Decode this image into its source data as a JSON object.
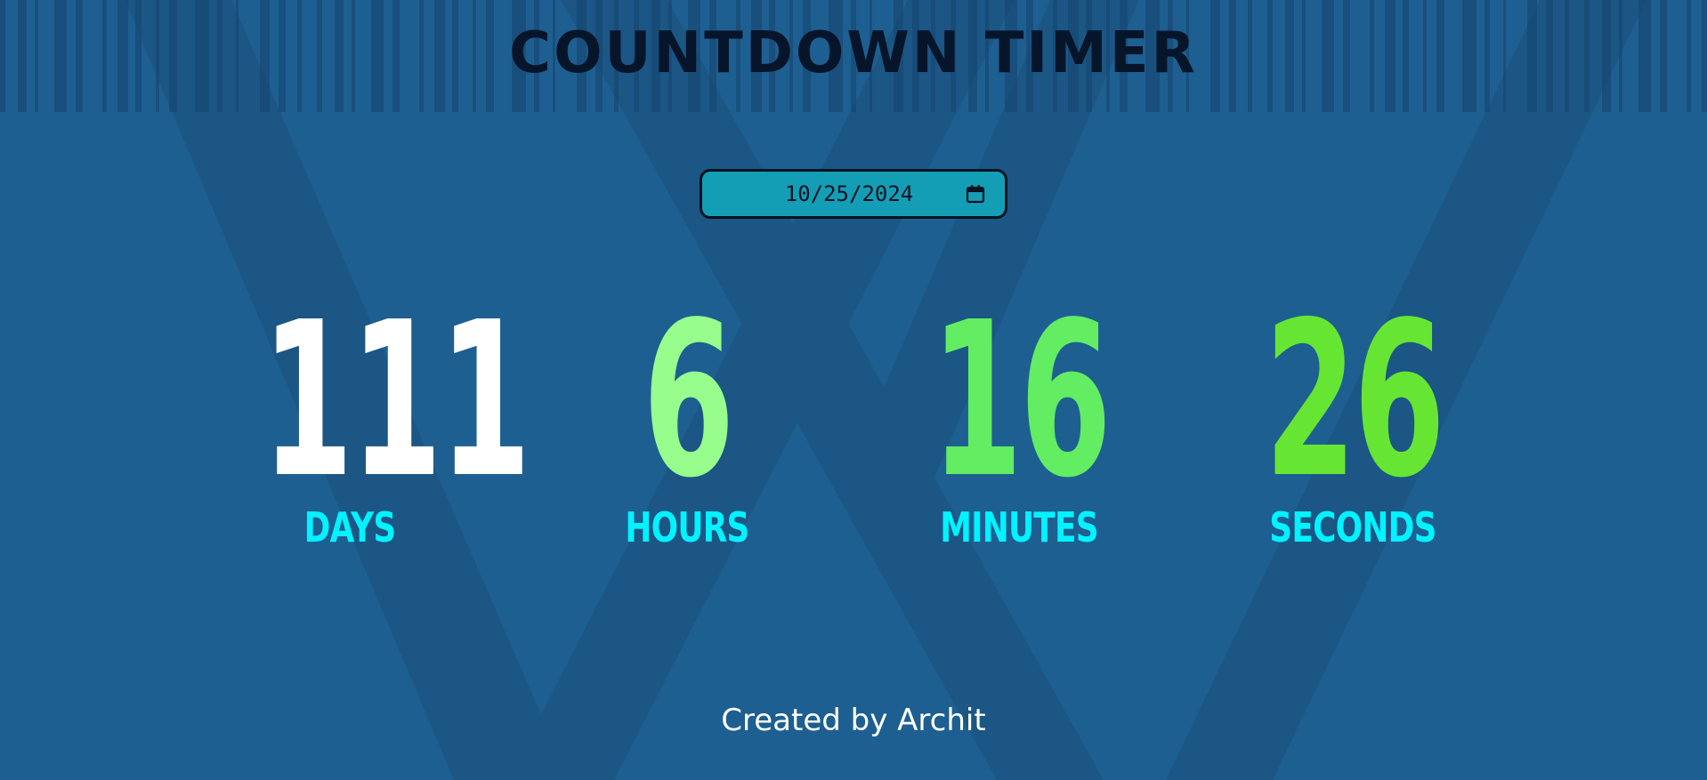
{
  "title": "COUNTDOWN TIMER",
  "date_input": {
    "value": "10/25/2024",
    "icon": "calendar-icon"
  },
  "countdown": [
    {
      "value": "111",
      "label": "DAYS",
      "color": "#ffffff"
    },
    {
      "value": "6",
      "label": "HOURS",
      "color": "#97fd8c"
    },
    {
      "value": "16",
      "label": "MINUTES",
      "color": "#62ed63"
    },
    {
      "value": "26",
      "label": "SECONDS",
      "color": "#66e632"
    }
  ],
  "label_color": "#00f3ff",
  "footer": "Created by Archit",
  "colors": {
    "background": "#1e5f91",
    "title": "#07152a",
    "input_background": "#139eb6"
  }
}
